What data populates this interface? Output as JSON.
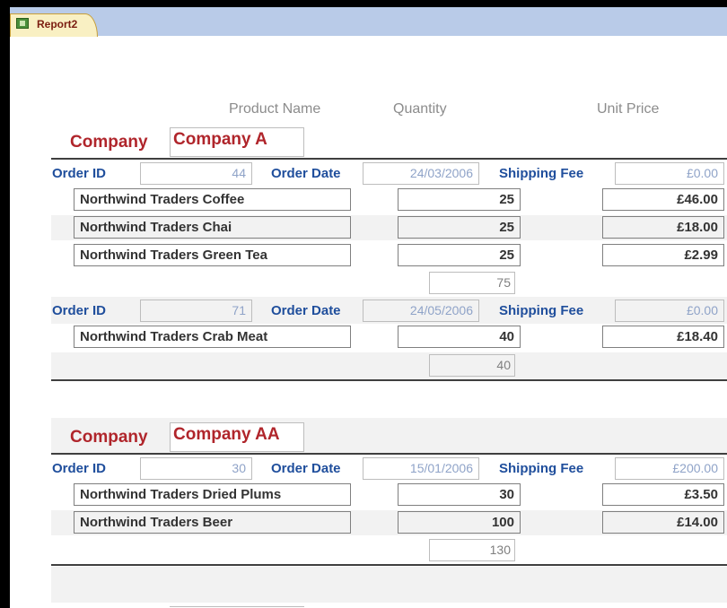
{
  "tab": {
    "label": "Report2"
  },
  "headers": {
    "product": "Product Name",
    "quantity": "Quantity",
    "unit_price": "Unit Price"
  },
  "labels": {
    "company": "Company",
    "order_id": "Order ID",
    "order_date": "Order Date",
    "shipping_fee": "Shipping Fee"
  },
  "groups": [
    {
      "company": "Company A",
      "orders": [
        {
          "order_id": "44",
          "order_date": "24/03/2006",
          "shipping_fee": "£0.00",
          "items": [
            {
              "product": "Northwind Traders Coffee",
              "quantity": "25",
              "unit_price": "£46.00"
            },
            {
              "product": "Northwind Traders Chai",
              "quantity": "25",
              "unit_price": "£18.00"
            },
            {
              "product": "Northwind Traders Green Tea",
              "quantity": "25",
              "unit_price": "£2.99"
            }
          ],
          "total_quantity": "75"
        },
        {
          "order_id": "71",
          "order_date": "24/05/2006",
          "shipping_fee": "£0.00",
          "items": [
            {
              "product": "Northwind Traders Crab Meat",
              "quantity": "40",
              "unit_price": "£18.40"
            }
          ],
          "total_quantity": "40"
        }
      ]
    },
    {
      "company": "Company AA",
      "orders": [
        {
          "order_id": "30",
          "order_date": "15/01/2006",
          "shipping_fee": "£200.00",
          "items": [
            {
              "product": "Northwind Traders Dried Plums",
              "quantity": "30",
              "unit_price": "£3.50"
            },
            {
              "product": "Northwind Traders Beer",
              "quantity": "100",
              "unit_price": "£14.00"
            }
          ],
          "total_quantity": "130"
        }
      ]
    }
  ],
  "colors": {
    "company_text": "#b0252b",
    "label_blue": "#1f4e9c",
    "value_blue": "#8fa3c8",
    "tab_bg": "#f9f0c3",
    "tabbar_bg": "#b9cbe8"
  }
}
